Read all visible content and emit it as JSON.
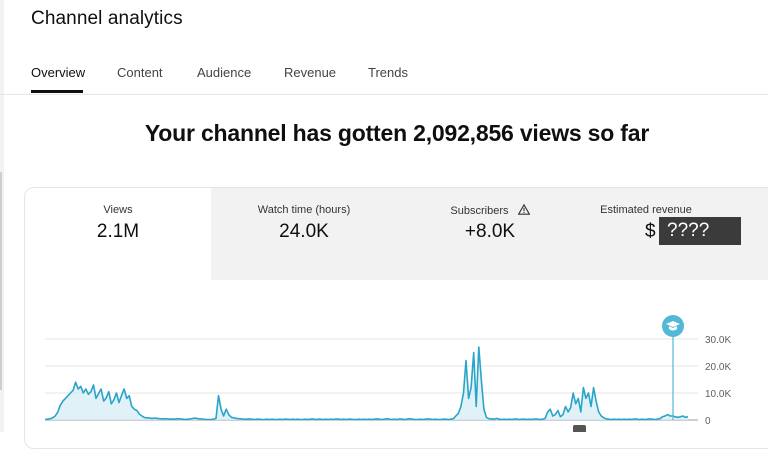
{
  "page": {
    "title": "Channel analytics"
  },
  "tabs": [
    {
      "label": "Overview",
      "active": true
    },
    {
      "label": "Content"
    },
    {
      "label": "Audience"
    },
    {
      "label": "Revenue"
    },
    {
      "label": "Trends"
    }
  ],
  "headline": "Your channel has gotten 2,092,856 views so far",
  "metrics": [
    {
      "label": "Views",
      "value": "2.1M",
      "active": true
    },
    {
      "label": "Watch time (hours)",
      "value": "24.0K"
    },
    {
      "label": "Subscribers",
      "value": "+8.0K",
      "icon": "warning-triangle-icon"
    },
    {
      "label": "Estimated revenue",
      "value_prefix": "$",
      "value_masked": "????"
    }
  ],
  "colors": {
    "accent": "#2aa4c9",
    "fill": "#d8eef5",
    "marker": "#53b8d6"
  },
  "chart_data": {
    "type": "area",
    "series": [
      {
        "values": [
          200,
          300,
          500,
          800,
          1500,
          3000,
          5500,
          7000,
          8000,
          9000,
          10000,
          11000,
          14000,
          11500,
          12500,
          10000,
          11500,
          9500,
          10500,
          13000,
          8000,
          9800,
          11500,
          7000,
          8200,
          10500,
          6000,
          7500,
          10000,
          6500,
          9000,
          11500,
          8000,
          9000,
          5000,
          4000,
          3500,
          2200,
          1500,
          900,
          800,
          700,
          600,
          700,
          600,
          500,
          400,
          500,
          400,
          300,
          400,
          300,
          500,
          400,
          300,
          200,
          300,
          400,
          600,
          700,
          500,
          400,
          300,
          200,
          150,
          200,
          300,
          600,
          9000,
          4000,
          1500,
          4000,
          2000,
          1000,
          800,
          600,
          500,
          400,
          300,
          300,
          400,
          300,
          200,
          300,
          300,
          200,
          200,
          300,
          200,
          300,
          200,
          200,
          300,
          200,
          300,
          300,
          200,
          300,
          200,
          300,
          200,
          200,
          300,
          200,
          300,
          400,
          200,
          300,
          300,
          200,
          300,
          200,
          300,
          200,
          400,
          300,
          200,
          300,
          200,
          300,
          300,
          200,
          200,
          300,
          200,
          300,
          200,
          300,
          200,
          300,
          400,
          300,
          200,
          300,
          500,
          300,
          200,
          300,
          200,
          400,
          300,
          200,
          300,
          500,
          300,
          200,
          200,
          300,
          200,
          300,
          400,
          300,
          200,
          300,
          200,
          200,
          300,
          300,
          200,
          300,
          500,
          1500,
          2500,
          5000,
          10000,
          22000,
          8000,
          12000,
          25000,
          5000,
          27000,
          15000,
          4000,
          1000,
          500,
          400,
          300,
          600,
          300,
          200,
          300,
          200,
          300,
          200,
          400,
          300,
          200,
          300,
          300,
          200,
          300,
          200,
          400,
          300,
          200,
          300,
          600,
          3000,
          4000,
          1500,
          2000,
          3500,
          1200,
          2000,
          5000,
          3000,
          4500,
          10000,
          6000,
          8000,
          3000,
          12000,
          8000,
          10000,
          5000,
          12000,
          7000,
          3000,
          1500,
          800,
          400,
          300,
          200,
          300,
          200,
          300,
          200,
          300,
          200,
          300,
          200,
          400,
          300,
          200,
          300,
          200,
          300,
          400,
          300,
          200,
          300,
          500,
          1200,
          1500,
          2000,
          1500,
          1500,
          1200,
          1000,
          1200,
          1500,
          1000,
          1200
        ],
        "color": "#2aa4c9"
      }
    ],
    "yticks": [
      "30.0K",
      "20.0K",
      "10.0K",
      "0"
    ],
    "ylim": [
      0,
      30000
    ]
  }
}
